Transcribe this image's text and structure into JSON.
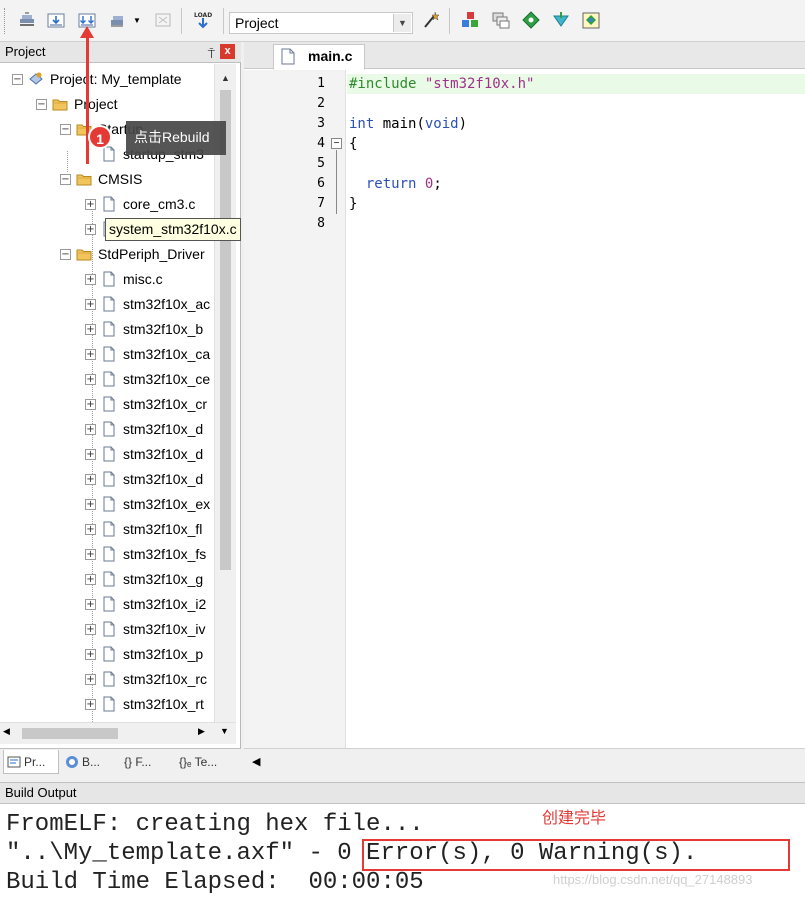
{
  "toolbar": {
    "target": "Project",
    "load_label": "LOAD"
  },
  "project_panel": {
    "title": "Project",
    "pin_glyph": "⍑",
    "close_glyph": "x",
    "tree": [
      {
        "label": "Project: My_template",
        "kind": "root",
        "level": 0,
        "expander": "−"
      },
      {
        "label": "Project",
        "kind": "folder",
        "level": 1,
        "expander": "−"
      },
      {
        "label": "Startup",
        "kind": "folder",
        "level": 2,
        "expander": "−"
      },
      {
        "label": "startup_stm3",
        "kind": "file",
        "level": 3,
        "expander": ""
      },
      {
        "label": "CMSIS",
        "kind": "folder",
        "level": 2,
        "expander": "−"
      },
      {
        "label": "core_cm3.c",
        "kind": "file",
        "level": 3,
        "expander": "+"
      },
      {
        "label": "system_stm32f10x.c",
        "kind": "file",
        "level": 3,
        "expander": "+"
      },
      {
        "label": "StdPeriph_Driver",
        "kind": "folder",
        "level": 2,
        "expander": "−"
      },
      {
        "label": "misc.c",
        "kind": "file",
        "level": 3,
        "expander": "+"
      },
      {
        "label": "stm32f10x_ac",
        "kind": "file",
        "level": 3,
        "expander": "+"
      },
      {
        "label": "stm32f10x_b",
        "kind": "file",
        "level": 3,
        "expander": "+"
      },
      {
        "label": "stm32f10x_ca",
        "kind": "file",
        "level": 3,
        "expander": "+"
      },
      {
        "label": "stm32f10x_ce",
        "kind": "file",
        "level": 3,
        "expander": "+"
      },
      {
        "label": "stm32f10x_cr",
        "kind": "file",
        "level": 3,
        "expander": "+"
      },
      {
        "label": "stm32f10x_d",
        "kind": "file",
        "level": 3,
        "expander": "+"
      },
      {
        "label": "stm32f10x_d",
        "kind": "file",
        "level": 3,
        "expander": "+"
      },
      {
        "label": "stm32f10x_d",
        "kind": "file",
        "level": 3,
        "expander": "+"
      },
      {
        "label": "stm32f10x_ex",
        "kind": "file",
        "level": 3,
        "expander": "+"
      },
      {
        "label": "stm32f10x_fl",
        "kind": "file",
        "level": 3,
        "expander": "+"
      },
      {
        "label": "stm32f10x_fs",
        "kind": "file",
        "level": 3,
        "expander": "+"
      },
      {
        "label": "stm32f10x_g",
        "kind": "file",
        "level": 3,
        "expander": "+"
      },
      {
        "label": "stm32f10x_i2",
        "kind": "file",
        "level": 3,
        "expander": "+"
      },
      {
        "label": "stm32f10x_iv",
        "kind": "file",
        "level": 3,
        "expander": "+"
      },
      {
        "label": "stm32f10x_p",
        "kind": "file",
        "level": 3,
        "expander": "+"
      },
      {
        "label": "stm32f10x_rc",
        "kind": "file",
        "level": 3,
        "expander": "+"
      },
      {
        "label": "stm32f10x_rt",
        "kind": "file",
        "level": 3,
        "expander": "+"
      }
    ],
    "tooltip": "system_stm32f10x.c",
    "tabs": [
      "Pr...",
      "B...",
      "{} F...",
      "{}ₑ Te..."
    ]
  },
  "editor": {
    "tab_label": "main.c",
    "lines": [
      {
        "n": "1",
        "tokens": [
          [
            "pp",
            "#include "
          ],
          [
            "str",
            "\"stm32f10x.h\""
          ]
        ]
      },
      {
        "n": "2",
        "tokens": []
      },
      {
        "n": "3",
        "tokens": [
          [
            "kw",
            "int"
          ],
          [
            "plain",
            " main("
          ],
          [
            "kw",
            "void"
          ],
          [
            "plain",
            ")"
          ]
        ]
      },
      {
        "n": "4",
        "tokens": [
          [
            "plain",
            "{"
          ]
        ]
      },
      {
        "n": "5",
        "tokens": []
      },
      {
        "n": "6",
        "tokens": [
          [
            "plain",
            "  "
          ],
          [
            "kw",
            "return"
          ],
          [
            "plain",
            " "
          ],
          [
            "num",
            "0"
          ],
          [
            "plain",
            ";"
          ]
        ]
      },
      {
        "n": "7",
        "tokens": [
          [
            "plain",
            "}"
          ]
        ]
      },
      {
        "n": "8",
        "tokens": []
      }
    ]
  },
  "build_output": {
    "title": "Build Output",
    "lines": [
      "FromELF: creating hex file...",
      "\"..\\My_template.axf\" - 0 Error(s), 0 Warning(s).",
      "Build Time Elapsed:  00:00:05"
    ]
  },
  "annotations": {
    "step_number": "1",
    "step_callout": "点击Rebuild",
    "done_label": "创建完毕",
    "watermark": "https://blog.csdn.net/qq_27148893",
    "accent_color": "#e53935"
  }
}
